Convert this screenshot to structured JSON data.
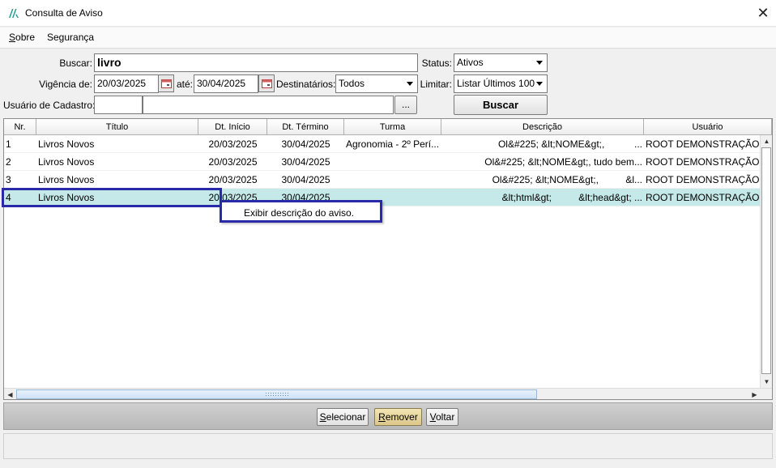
{
  "window": {
    "title": "Consulta de Aviso"
  },
  "menu": [
    {
      "accel": "S",
      "rest": "obre"
    },
    {
      "accel": "",
      "rest": "Segurança"
    }
  ],
  "form": {
    "buscar_label": "Buscar:",
    "buscar_value": "livro",
    "status_label": "Status:",
    "status_value": "Ativos",
    "vigencia_label": "Vigência de:",
    "vigencia_de": "20/03/2025",
    "ate_label": "até:",
    "vigencia_ate": "30/04/2025",
    "destinatarios_label": "Destinatários:",
    "destinatarios_value": "Todos",
    "limitar_label": "Limitar:",
    "limitar_value": "Listar Últimos 100",
    "usuario_label": "Usuário de Cadastro:",
    "usuario_code": "",
    "usuario_name": "",
    "ellipsis_label": "...",
    "buscar_button": "Buscar"
  },
  "table": {
    "columns": [
      "Nr.",
      "Título",
      "Dt. Início",
      "Dt. Término",
      "Turma",
      "Descrição",
      "Usuário"
    ],
    "rows": [
      {
        "nr": "1",
        "titulo": "Livros Novos",
        "inicio": "20/03/2025",
        "termino": "30/04/2025",
        "turma": "Agronomia - 2º Perí...",
        "descricao": "Ol&#225; &lt;NOME&gt;,           ...",
        "usuario": "ROOT DEMONSTRAÇÃO JA"
      },
      {
        "nr": "2",
        "titulo": "Livros Novos",
        "inicio": "20/03/2025",
        "termino": "30/04/2025",
        "turma": "",
        "descricao": "Ol&#225; &lt;NOME&gt;, tudo bem...",
        "usuario": "ROOT DEMONSTRAÇÃO JA"
      },
      {
        "nr": "3",
        "titulo": "Livros Novos",
        "inicio": "20/03/2025",
        "termino": "30/04/2025",
        "turma": "",
        "descricao": "Ol&#225; &lt;NOME&gt;,          &l...",
        "usuario": "ROOT DEMONSTRAÇÃO JA"
      },
      {
        "nr": "4",
        "titulo": "Livros Novos",
        "inicio": "20/03/2025",
        "termino": "30/04/2025",
        "turma": "",
        "descricao": "&lt;html&gt;          &lt;head&gt; ...",
        "usuario": "ROOT DEMONSTRAÇÃO JA"
      }
    ],
    "selected_row": 4
  },
  "context_menu": {
    "item": "Exibir descrição do aviso."
  },
  "buttons": [
    {
      "accel": "S",
      "rest": "elecionar"
    },
    {
      "accel": "R",
      "rest": "emover"
    },
    {
      "accel": "V",
      "rest": "oltar"
    }
  ],
  "colors": {
    "accent_border": "#2a2aa8",
    "selected_row": "#c5e8e8",
    "remover_button": "#e8d9a0"
  }
}
